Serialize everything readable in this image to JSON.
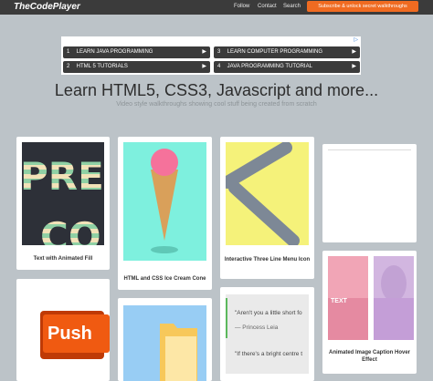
{
  "header": {
    "logo": "TheCodePlayer",
    "nav": [
      "Follow",
      "Contact",
      "Search"
    ],
    "cta": "Subscribe & unlock secret walkthroughs"
  },
  "ad": {
    "close": "▷",
    "links": [
      {
        "num": "1",
        "label": "LEARN JAVA PROGRAMMING"
      },
      {
        "num": "3",
        "label": "LEARN COMPUTER PROGRAMMING"
      },
      {
        "num": "2",
        "label": "HTML 5 TUTORIALS"
      },
      {
        "num": "4",
        "label": "JAVA PROGRAMMING TUTORIAL"
      }
    ],
    "arrow": "▶"
  },
  "hero": {
    "title": "Learn HTML5, CSS3, Javascript and more...",
    "subtitle": "Video style walkthroughs showing cool stuff being created from scratch"
  },
  "cards": {
    "text_fill": {
      "title": "Text with Animated Fill",
      "text_top": "PRE",
      "text_bottom": "CO"
    },
    "ice_cream": {
      "title": "HTML and CSS Ice Cream Cone"
    },
    "three_line": {
      "title": "Interactive Three Line Menu Icon"
    },
    "caption": {
      "title": "Animated Image Caption Hover Effect",
      "overlay": "TEXT"
    },
    "push": {
      "text": "Push"
    },
    "quotes": {
      "quote1": "\"Aren't you a little short fo",
      "author1": "— Princess Leia",
      "quote2": "\"If there's a bright centre t"
    }
  },
  "colors": {
    "accent_orange": "#f06b21",
    "topbar": "#3b3b3b",
    "background": "#bcc3c8"
  }
}
